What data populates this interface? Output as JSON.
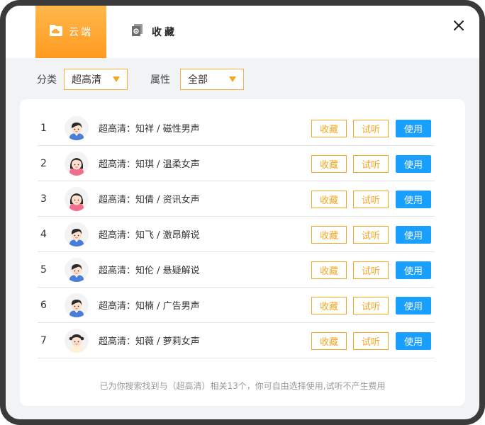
{
  "tabs": {
    "cloud": {
      "label": "云端",
      "icon": "cloud-folder-icon"
    },
    "favorites": {
      "label": "收藏",
      "icon": "favorites-box-icon"
    }
  },
  "filters": {
    "category": {
      "label": "分类",
      "value": "超高清"
    },
    "attribute": {
      "label": "属性",
      "value": "全部"
    }
  },
  "voices": [
    {
      "index": "1",
      "label": "超高清：知祥 / 磁性男声",
      "avatar": "male"
    },
    {
      "index": "2",
      "label": "超高清：知琪 / 温柔女声",
      "avatar": "female"
    },
    {
      "index": "3",
      "label": "超高清：知倩 / 资讯女声",
      "avatar": "female"
    },
    {
      "index": "4",
      "label": "超高清：知飞 / 激昂解说",
      "avatar": "male"
    },
    {
      "index": "5",
      "label": "超高清：知伦 / 悬疑解说",
      "avatar": "male"
    },
    {
      "index": "6",
      "label": "超高清：知楠 / 广告男声",
      "avatar": "male"
    },
    {
      "index": "7",
      "label": "超高清：知薇 / 萝莉女声",
      "avatar": "girl"
    }
  ],
  "actions": {
    "favorite": "收藏",
    "listen": "试听",
    "use": "使用"
  },
  "footer": "已为你搜索找到与（超高清）相关13个，你可自由选择使用,试听不产生费用",
  "colors": {
    "accent": "#f5a623",
    "primary": "#19a0ff",
    "tab_active": "#ff9a1f"
  }
}
